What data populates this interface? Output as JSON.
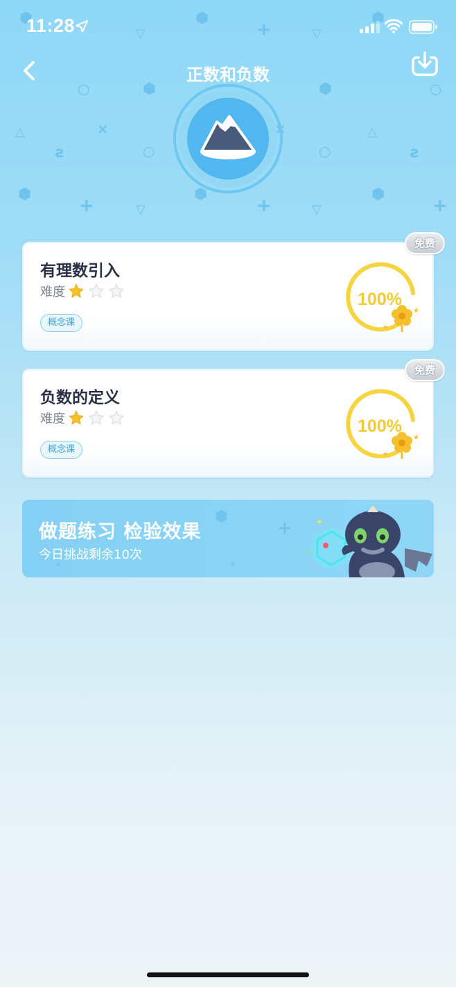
{
  "status_bar": {
    "time": "11:28"
  },
  "header": {
    "title": "正数和负数"
  },
  "lessons": [
    {
      "title": "有理数引入",
      "difficulty_label": "难度",
      "difficulty_stars": 1,
      "max_stars": 3,
      "tag": "概念课",
      "progress": "100%",
      "badge": "免费"
    },
    {
      "title": "负数的定义",
      "difficulty_label": "难度",
      "difficulty_stars": 1,
      "max_stars": 3,
      "tag": "概念课",
      "progress": "100%",
      "badge": "免费"
    }
  ],
  "practice": {
    "title": "做题练习 检验效果",
    "subtitle": "今日挑战剩余10次"
  },
  "colors": {
    "accent_yellow": "#f5d440",
    "star_active": "#f6c02c",
    "tag_blue": "#3fa4d8",
    "bg_sky": "#8fd8f7"
  }
}
